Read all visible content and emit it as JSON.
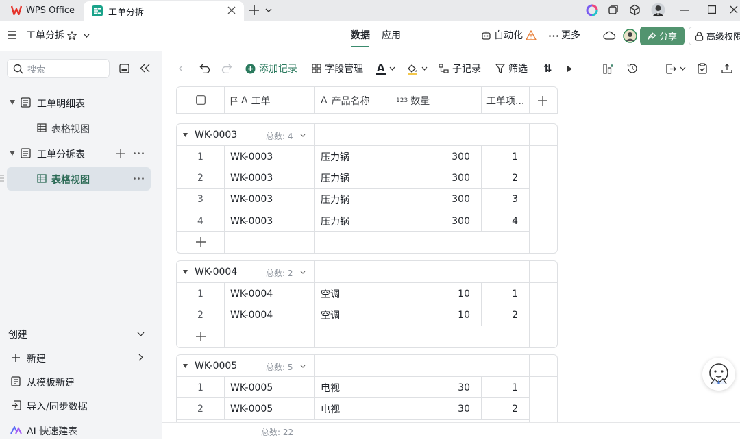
{
  "titlebar": {
    "app_tab": "WPS Office",
    "doc_tab": "工单分拆"
  },
  "header": {
    "doc_title": "工单分拆",
    "tabs": [
      "数据",
      "应用"
    ],
    "automation": "自动化",
    "more": "更多",
    "share": "分享",
    "permission": "高级权限"
  },
  "sidebar": {
    "search_placeholder": "搜索",
    "tree": [
      {
        "label": "工单明细表",
        "views": [
          "表格视图"
        ]
      },
      {
        "label": "工单分拆表",
        "views": [
          "表格视图"
        ]
      }
    ],
    "create_title": "创建",
    "create_items": [
      "新建",
      "从模板新建",
      "导入/同步数据",
      "AI 快速建表"
    ]
  },
  "toolbar": {
    "add_record": "添加记录",
    "field_manage": "字段管理",
    "text_color": "A",
    "sub_record": "子记录",
    "filter": "筛选",
    "sort": "⇅"
  },
  "table": {
    "columns": [
      {
        "label": "工单",
        "type_icon": "A"
      },
      {
        "label": "产品名称",
        "type_icon": "A"
      },
      {
        "label": "数量",
        "type_icon": "123"
      },
      {
        "label": "工单项..."
      }
    ],
    "count_label": "总数:",
    "groups": [
      {
        "name": "WK-0003",
        "count": "4",
        "rows": [
          {
            "idx": "1",
            "order": "WK-0003",
            "product": "压力锅",
            "qty": "300",
            "item": "1"
          },
          {
            "idx": "2",
            "order": "WK-0003",
            "product": "压力锅",
            "qty": "300",
            "item": "2"
          },
          {
            "idx": "3",
            "order": "WK-0003",
            "product": "压力锅",
            "qty": "300",
            "item": "3"
          },
          {
            "idx": "4",
            "order": "WK-0003",
            "product": "压力锅",
            "qty": "300",
            "item": "4"
          }
        ]
      },
      {
        "name": "WK-0004",
        "count": "2",
        "rows": [
          {
            "idx": "1",
            "order": "WK-0004",
            "product": "空调",
            "qty": "10",
            "item": "1"
          },
          {
            "idx": "2",
            "order": "WK-0004",
            "product": "空调",
            "qty": "10",
            "item": "2"
          }
        ]
      },
      {
        "name": "WK-0005",
        "count": "5",
        "rows": [
          {
            "idx": "1",
            "order": "WK-0005",
            "product": "电视",
            "qty": "30",
            "item": "1"
          },
          {
            "idx": "2",
            "order": "WK-0005",
            "product": "电视",
            "qty": "30",
            "item": "2"
          }
        ]
      }
    ],
    "total_label": "总数:",
    "total": "22"
  },
  "colors": {
    "accent": "#3b8b6e",
    "share": "#52946f",
    "sidebar_bg": "#f3f4f6",
    "active_row": "#dde3e9"
  }
}
